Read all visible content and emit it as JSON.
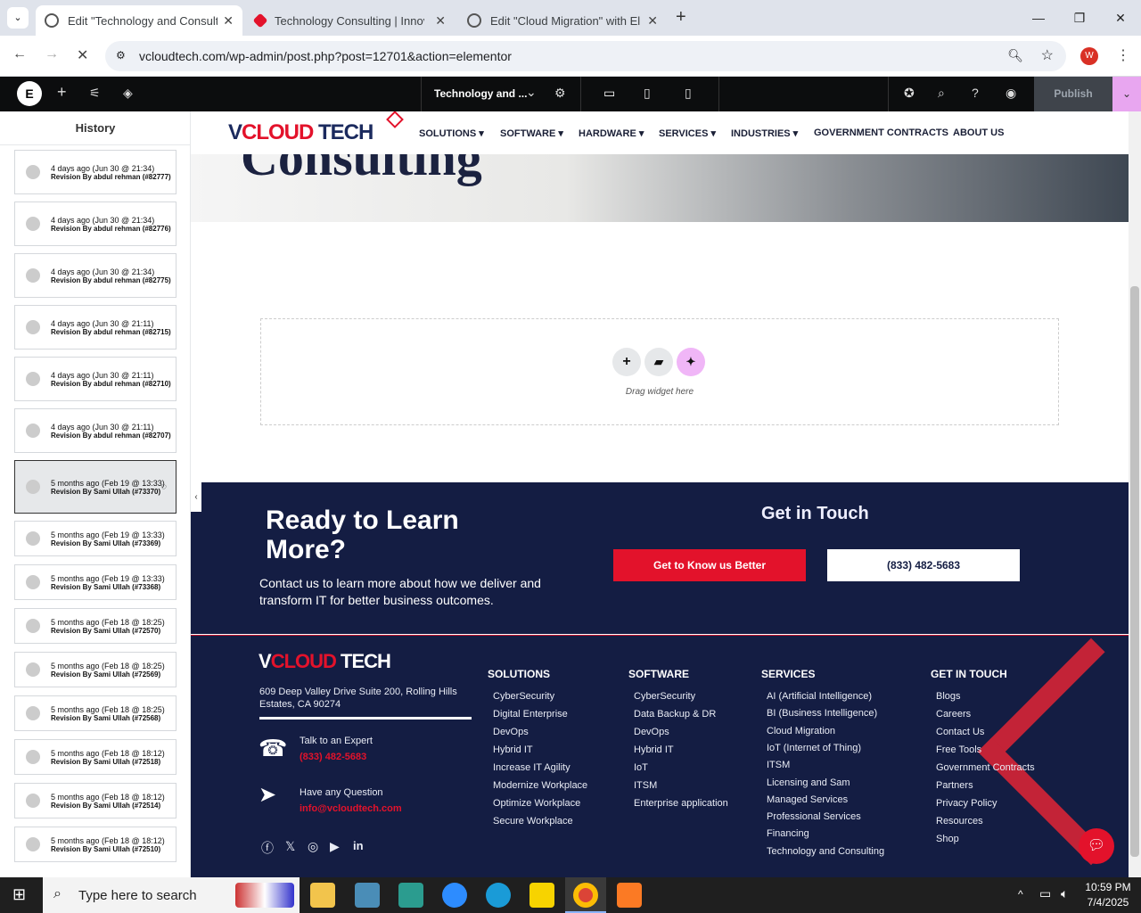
{
  "browser": {
    "tabs": [
      {
        "title": "Edit \"Technology and Consultin",
        "active": true
      },
      {
        "title": "Technology Consulting | Innova",
        "active": false
      },
      {
        "title": "Edit \"Cloud Migration\" with Ele",
        "active": false
      }
    ],
    "url": "vcloudtech.com/wp-admin/post.php?post=12701&action=elementor",
    "profile_initial": "W"
  },
  "editor": {
    "page_name": "Technology and ...",
    "publish_label": "Publish",
    "panel_title": "History",
    "history": [
      {
        "date": "4 days ago (Jun 30 @ 21:34)",
        "rev": "Revision By abdul rehman (#82777)"
      },
      {
        "date": "4 days ago (Jun 30 @ 21:34)",
        "rev": "Revision By abdul rehman (#82776)"
      },
      {
        "date": "4 days ago (Jun 30 @ 21:34)",
        "rev": "Revision By abdul rehman (#82775)"
      },
      {
        "date": "4 days ago (Jun 30 @ 21:11)",
        "rev": "Revision By abdul rehman (#82715)"
      },
      {
        "date": "4 days ago (Jun 30 @ 21:11)",
        "rev": "Revision By abdul rehman (#82710)"
      },
      {
        "date": "4 days ago (Jun 30 @ 21:11)",
        "rev": "Revision By abdul rehman (#82707)"
      },
      {
        "date": "5 months ago (Feb 19 @ 13:33)",
        "rev": "Revision By Sami Ullah (#73370)"
      },
      {
        "date": "5 months ago (Feb 19 @ 13:33)",
        "rev": "Revision By Sami Ullah (#73369)"
      },
      {
        "date": "5 months ago (Feb 19 @ 13:33)",
        "rev": "Revision By Sami Ullah (#73368)"
      },
      {
        "date": "5 months ago (Feb 18 @ 18:25)",
        "rev": "Revision By Sami Ullah (#72570)"
      },
      {
        "date": "5 months ago (Feb 18 @ 18:25)",
        "rev": "Revision By Sami Ullah (#72569)"
      },
      {
        "date": "5 months ago (Feb 18 @ 18:25)",
        "rev": "Revision By Sami Ullah (#72568)"
      },
      {
        "date": "5 months ago (Feb 18 @ 18:12)",
        "rev": "Revision By Sami Ullah (#72518)"
      },
      {
        "date": "5 months ago (Feb 18 @ 18:12)",
        "rev": "Revision By Sami Ullah (#72514)"
      },
      {
        "date": "5 months ago (Feb 18 @ 18:12)",
        "rev": "Revision By Sami Ullah (#72510)"
      }
    ]
  },
  "site": {
    "logo_v": "V",
    "logo_cloud": "CLOUD",
    "logo_tech": " TECH",
    "nav": [
      "SOLUTIONS",
      "SOFTWARE",
      "HARDWARE",
      "SERVICES",
      "INDUSTRIES",
      "GOVERNMENT CONTRACTS",
      "ABOUT US"
    ],
    "hero_title": "Consulting",
    "drag_label": "Drag widget here",
    "cta_title": "Ready to Learn More?",
    "cta_text": "Contact us to learn more about how we deliver and transform IT for better business outcomes.",
    "touch_title": "Get in Touch",
    "btn_know": "Get to Know us Better",
    "btn_phone": "(833) 482-5683",
    "address": "609 Deep Valley Drive Suite 200, Rolling Hills Estates, CA 90274",
    "talk_label": "Talk to an Expert",
    "talk_phone": "(833) 482-5683",
    "question_label": "Have any Question",
    "email": "info@vcloudtech.com",
    "cols": [
      {
        "h": "SOLUTIONS",
        "items": [
          "CyberSecurity",
          "Digital Enterprise",
          "DevOps",
          "Hybrid IT",
          "Increase IT Agility",
          "Modernize Workplace",
          "Optimize Workplace",
          "Secure Workplace"
        ]
      },
      {
        "h": "SOFTWARE",
        "items": [
          "CyberSecurity",
          "Data Backup & DR",
          "DevOps",
          "Hybrid IT",
          "IoT",
          "ITSM",
          "Enterprise application"
        ]
      },
      {
        "h": "SERVICES",
        "items": [
          "AI (Artificial Intelligence)",
          "BI (Business Intelligence)",
          "Cloud Migration",
          "IoT (Internet of Thing)",
          "ITSM",
          "Licensing and Sam",
          "Managed Services",
          "Professional Services",
          "Financing",
          "Technology and Consulting"
        ]
      },
      {
        "h": "GET IN TOUCH",
        "items": [
          "Blogs",
          "Careers",
          "Contact Us",
          "Free Tools",
          "Government Contracts",
          "Partners",
          "Privacy Policy",
          "Resources",
          "Shop"
        ]
      }
    ]
  },
  "taskbar": {
    "search_placeholder": "Type here to search",
    "time": "10:59 PM",
    "date": "7/4/2025"
  }
}
